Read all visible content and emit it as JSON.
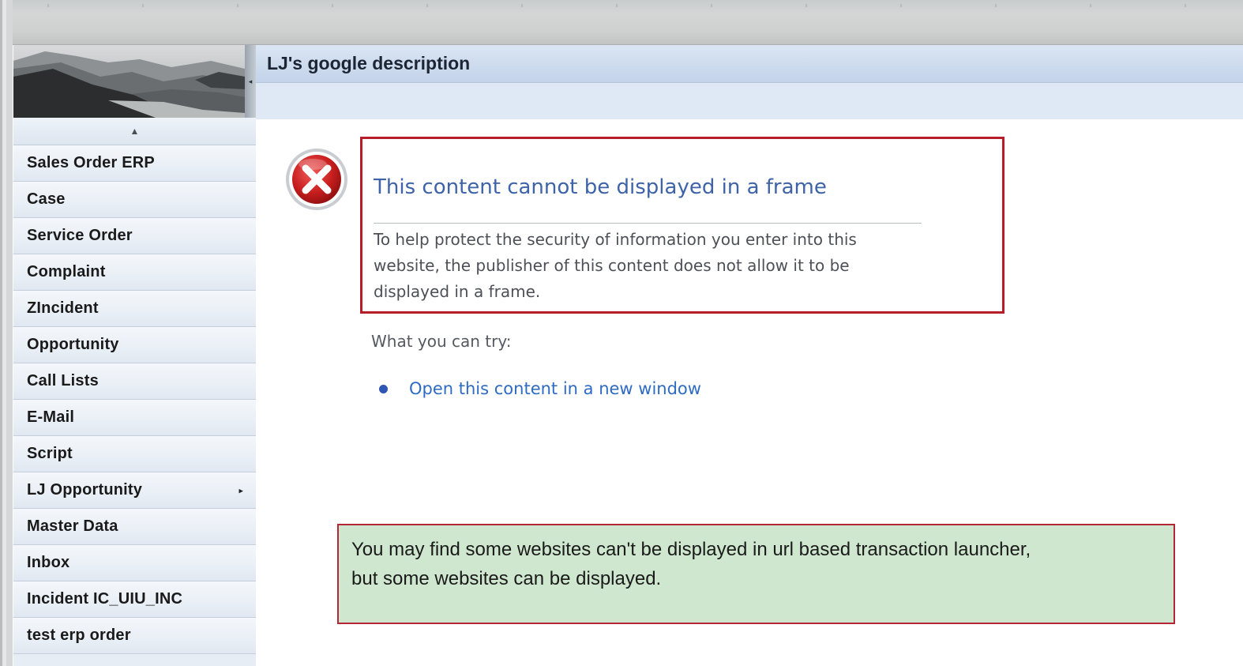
{
  "header": {
    "title": "LJ's google description"
  },
  "sidebar": {
    "scroll_up_glyph": "▲",
    "items": [
      {
        "label": "Sales Order ERP"
      },
      {
        "label": "Case"
      },
      {
        "label": "Service Order"
      },
      {
        "label": "Complaint"
      },
      {
        "label": "ZIncident"
      },
      {
        "label": "Opportunity"
      },
      {
        "label": "Call Lists"
      },
      {
        "label": "E-Mail"
      },
      {
        "label": "Script"
      },
      {
        "label": "LJ Opportunity",
        "has_submenu": true,
        "submenu_glyph": "▸"
      },
      {
        "label": "Master Data"
      },
      {
        "label": "Inbox"
      },
      {
        "label": "Incident IC_UIU_INC"
      },
      {
        "label": "test erp order"
      }
    ]
  },
  "error": {
    "icon": "error-x-icon",
    "title": "This content cannot be displayed in a frame",
    "body": "To help protect the security of information you enter into this website, the publisher of this content does not allow it to be displayed in a frame.",
    "try_label": "What you can try:",
    "link": "Open this content in a new window"
  },
  "note": {
    "text_line1": "You may find some websites can't be displayed in url based transaction launcher,",
    "text_line2": "but some websites can be displayed."
  },
  "colors": {
    "error_border": "#b61e2a",
    "note_background": "#cfe7cf",
    "link": "#2e6bc4",
    "header_background": "#cfdcee"
  }
}
